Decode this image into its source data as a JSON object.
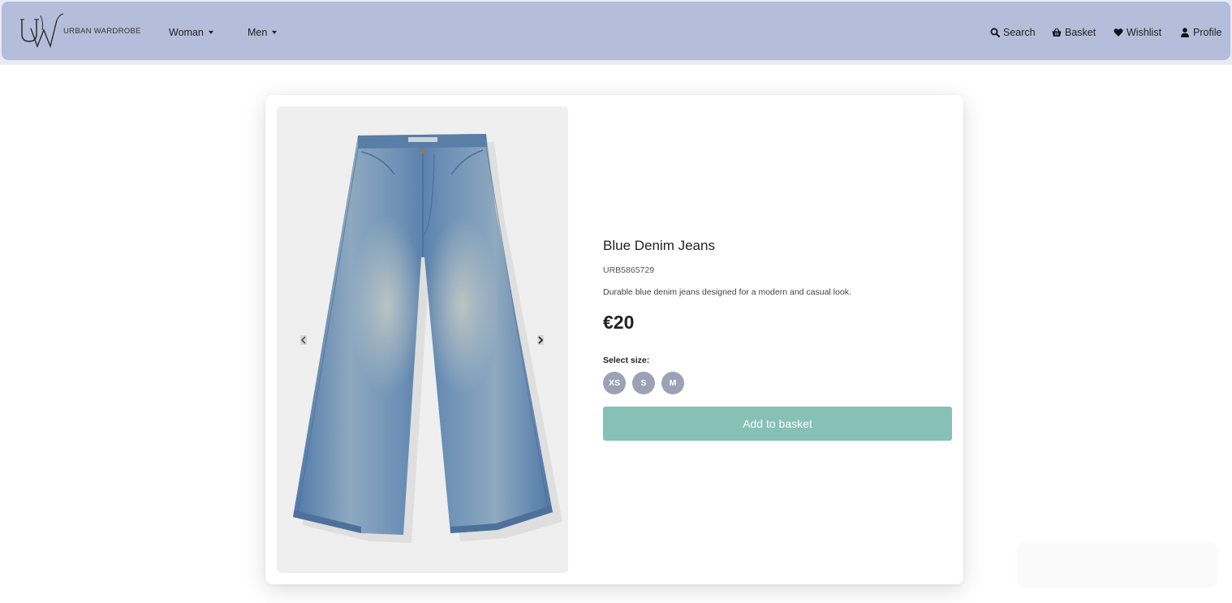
{
  "header": {
    "brand_name": "URBAN WARDROBE",
    "logo_monogram": "UW",
    "nav": [
      {
        "label": "Woman"
      },
      {
        "label": "Men"
      }
    ],
    "actions": [
      {
        "label": "Search",
        "icon": "search-icon"
      },
      {
        "label": "Basket",
        "icon": "basket-icon"
      },
      {
        "label": "Wishlist",
        "icon": "heart-icon"
      },
      {
        "label": "Profile",
        "icon": "user-icon"
      }
    ]
  },
  "product": {
    "title": "Blue Denim Jeans",
    "sku": "URB5865729",
    "description": "Durable blue denim jeans designed for a modern and casual look.",
    "price": "€20",
    "size_label": "Select size:",
    "sizes": [
      "XS",
      "S",
      "M"
    ],
    "add_button_label": "Add to basket",
    "image_alt": "blue wide-leg denim jeans"
  },
  "colors": {
    "navbar_bg": "#b4bedb",
    "size_button_bg": "#9ca2b5",
    "add_button_bg": "#86c0b6",
    "image_panel_bg": "#efefef"
  }
}
